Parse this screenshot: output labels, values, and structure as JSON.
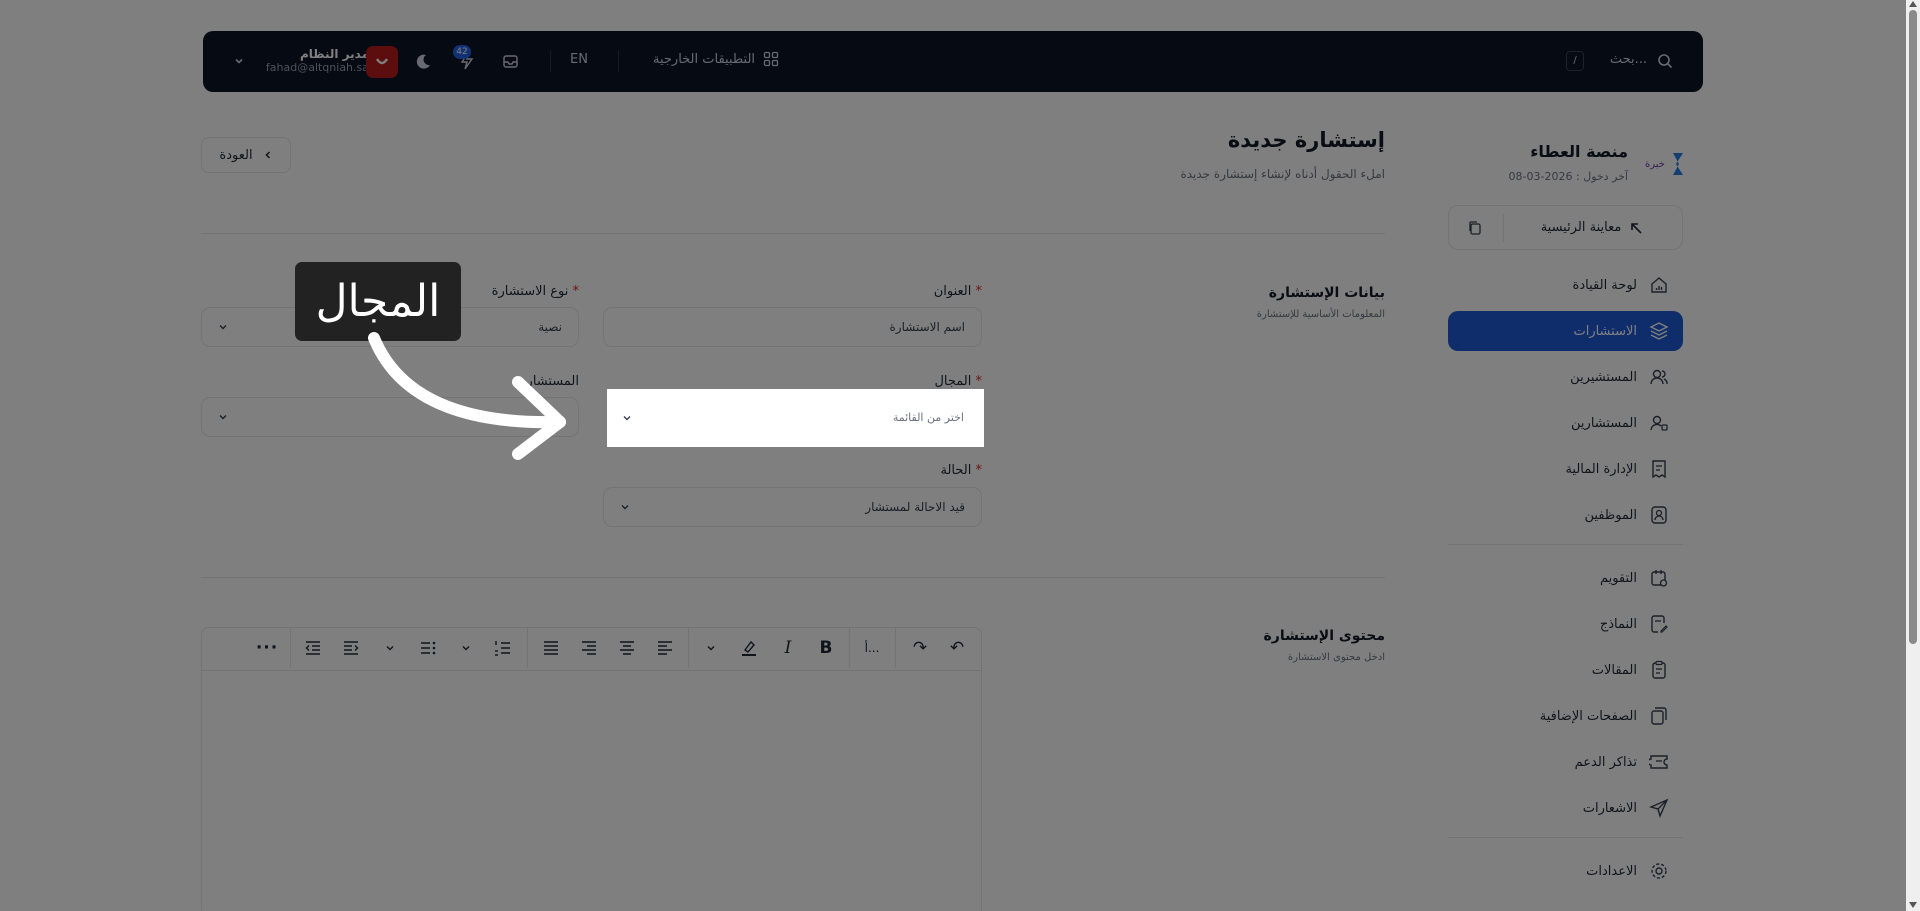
{
  "topbar": {
    "search_placeholder": "بحث...",
    "search_shortcut": "/",
    "external_apps_label": "التطبيقات الخارجية",
    "language_label": "EN",
    "notifications_count": "42",
    "user_name": "مدير النظام",
    "user_email": "fahad@altqniah.sa"
  },
  "sidebar": {
    "brand_title": "منصة العطاء",
    "last_login": "آخر دخول : 2026-03-08",
    "preview_home_label": "معاينة الرئيسية",
    "items": [
      {
        "label": "لوحة القيادة",
        "icon": "dashboard-icon"
      },
      {
        "label": "الاستشارات",
        "icon": "layers-icon",
        "active": true
      },
      {
        "label": "المستشيرين",
        "icon": "users-icon"
      },
      {
        "label": "المستشارين",
        "icon": "consultant-icon"
      },
      {
        "label": "الإدارة المالية",
        "icon": "finance-icon"
      },
      {
        "label": "الموظفين",
        "icon": "employee-icon"
      },
      {
        "label": "التقويم",
        "icon": "calendar-icon"
      },
      {
        "label": "النماذج",
        "icon": "forms-icon"
      },
      {
        "label": "المقالات",
        "icon": "articles-icon"
      },
      {
        "label": "الصفحات الإضافية",
        "icon": "pages-icon"
      },
      {
        "label": "تذاكر الدعم",
        "icon": "ticket-icon"
      },
      {
        "label": "الاشعارات",
        "icon": "send-icon"
      },
      {
        "label": "الاعدادات",
        "icon": "gear-icon"
      }
    ]
  },
  "page": {
    "title": "إستشارة جديدة",
    "subtitle": "املء الحقول أدناه لإنشاء إستشارة جديدة",
    "back_label": "العودة"
  },
  "section_details": {
    "title": "بيانات الإستشارة",
    "subtitle": "المعلومات الأساسية للإستشارة"
  },
  "form": {
    "title_label": "العنوان",
    "title_value": "اسم الاستشارة",
    "type_label": "نوع الاستشارة",
    "type_value": "نصية",
    "field_label": "المجال",
    "field_placeholder": "اختر من القائمة",
    "consultant_label": "المستشار",
    "status_label": "الحالة",
    "status_value": "قيد الاحالة لمستشار",
    "required_mark": "*"
  },
  "section_content": {
    "title": "محتوى الإستشارة",
    "subtitle": "ادخل محتوى الاستشارة"
  },
  "editor": {
    "undo": "↶",
    "redo": "↷",
    "heading_dropdown": "أ...",
    "bold": "B",
    "italic": "I",
    "more": "···"
  },
  "callout": {
    "label": "المجال"
  },
  "colors": {
    "accent": "#1e5bd6",
    "topbar": "#0c1426",
    "danger": "#dc2626"
  }
}
